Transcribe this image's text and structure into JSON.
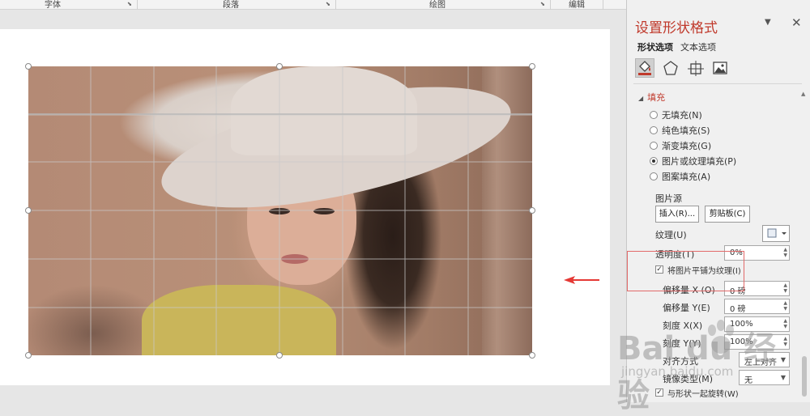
{
  "ribbon": {
    "groups": [
      {
        "label": "字体"
      },
      {
        "label": "段落"
      },
      {
        "label": "绘图"
      },
      {
        "label": "编辑"
      }
    ]
  },
  "pane": {
    "title": "设置形状格式",
    "tabs": [
      "形状选项",
      "文本选项"
    ],
    "icons": [
      "fill-line-icon",
      "effects-pentagon-icon",
      "size-properties-icon",
      "picture-icon"
    ],
    "fill": {
      "section_title": "填充",
      "options": [
        {
          "label": "无填充(N)",
          "selected": false
        },
        {
          "label": "纯色填充(S)",
          "selected": false
        },
        {
          "label": "渐变填充(G)",
          "selected": false
        },
        {
          "label": "图片或纹理填充(P)",
          "selected": true
        },
        {
          "label": "图案填充(A)",
          "selected": false
        }
      ],
      "picture_source_label": "图片源",
      "insert_button": "插入(R)...",
      "clipboard_button": "剪贴板(C)",
      "texture_label": "纹理(U)",
      "transparency_label": "透明度(T)",
      "transparency_value": "0%",
      "tile_checkbox_label": "将图片平铺为纹理(I)",
      "tile_checked": true,
      "offset_x_label": "偏移量 X (O)",
      "offset_x_value": "0 磅",
      "offset_y_label": "偏移量 Y(E)",
      "offset_y_value": "0 磅",
      "scale_x_label": "刻度 X(X)",
      "scale_x_value": "100%",
      "scale_y_label": "刻度 Y(Y)",
      "scale_y_value": "100%",
      "alignment_label": "对齐方式",
      "alignment_value": "左上对齐",
      "mirror_label": "镜像类型(M)",
      "mirror_value": "无",
      "rotate_checkbox_label": "与形状一起旋转(W)",
      "rotate_checked": true
    }
  },
  "watermark": {
    "main": "Bai du 经验",
    "sub": "jingyan.baidu.com"
  },
  "colors": {
    "accent": "#c0392b",
    "arrow": "#e53935"
  }
}
